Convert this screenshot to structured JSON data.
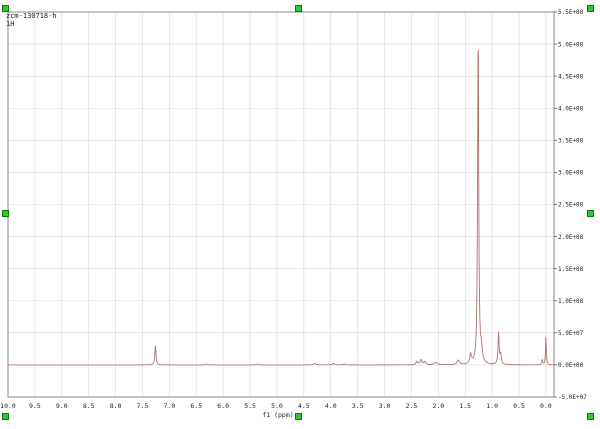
{
  "header": {
    "sample_name": "zcm-130718-h",
    "experiment": "1H"
  },
  "colors": {
    "spectrum": "#b87070",
    "grid": "#d9d9d9",
    "border": "#888888",
    "handle": "#2ecc2e"
  },
  "chart_data": {
    "type": "line",
    "title": "",
    "xlabel": "f1 (ppm)",
    "ylabel": "",
    "xlim": [
      10.0,
      -0.15
    ],
    "ylim": [
      -50000000,
      550000000
    ],
    "x_reversed": true,
    "grid": true,
    "x_ticks": [
      "10.0",
      "9.5",
      "9.0",
      "8.5",
      "8.0",
      "7.5",
      "7.0",
      "6.5",
      "6.0",
      "5.5",
      "5.0",
      "4.5",
      "4.0",
      "3.5",
      "3.0",
      "2.5",
      "2.0",
      "1.5",
      "1.0",
      "0.5",
      "0.0"
    ],
    "y_ticks": [
      "5.5E+08",
      "5.0E+08",
      "4.5E+08",
      "4.0E+08",
      "3.5E+08",
      "3.0E+08",
      "2.5E+08",
      "2.0E+08",
      "1.5E+08",
      "1.0E+08",
      "5.0E+07",
      "0.0E+00",
      "-5.0E+07"
    ],
    "peaks": [
      {
        "ppm": 7.26,
        "intensity": 30000000,
        "width": 0.012
      },
      {
        "ppm": 6.3,
        "intensity": 1200000,
        "width": 0.02
      },
      {
        "ppm": 5.35,
        "intensity": 1500000,
        "width": 0.02
      },
      {
        "ppm": 4.3,
        "intensity": 2500000,
        "width": 0.02
      },
      {
        "ppm": 3.95,
        "intensity": 2500000,
        "width": 0.02
      },
      {
        "ppm": 3.75,
        "intensity": 1500000,
        "width": 0.02
      },
      {
        "ppm": 2.4,
        "intensity": 5000000,
        "width": 0.02
      },
      {
        "ppm": 2.32,
        "intensity": 8000000,
        "width": 0.02
      },
      {
        "ppm": 2.25,
        "intensity": 5000000,
        "width": 0.02
      },
      {
        "ppm": 2.05,
        "intensity": 4000000,
        "width": 0.03
      },
      {
        "ppm": 1.63,
        "intensity": 7000000,
        "width": 0.025
      },
      {
        "ppm": 1.4,
        "intensity": 15000000,
        "width": 0.02
      },
      {
        "ppm": 1.26,
        "intensity": 530000000,
        "width": 0.012
      },
      {
        "ppm": 1.2,
        "intensity": 20000000,
        "width": 0.02
      },
      {
        "ppm": 0.88,
        "intensity": 50000000,
        "width": 0.012
      },
      {
        "ppm": 0.84,
        "intensity": 15000000,
        "width": 0.015
      },
      {
        "ppm": 0.07,
        "intensity": 8000000,
        "width": 0.01
      },
      {
        "ppm": 0.0,
        "intensity": 47000000,
        "width": 0.008
      }
    ]
  }
}
